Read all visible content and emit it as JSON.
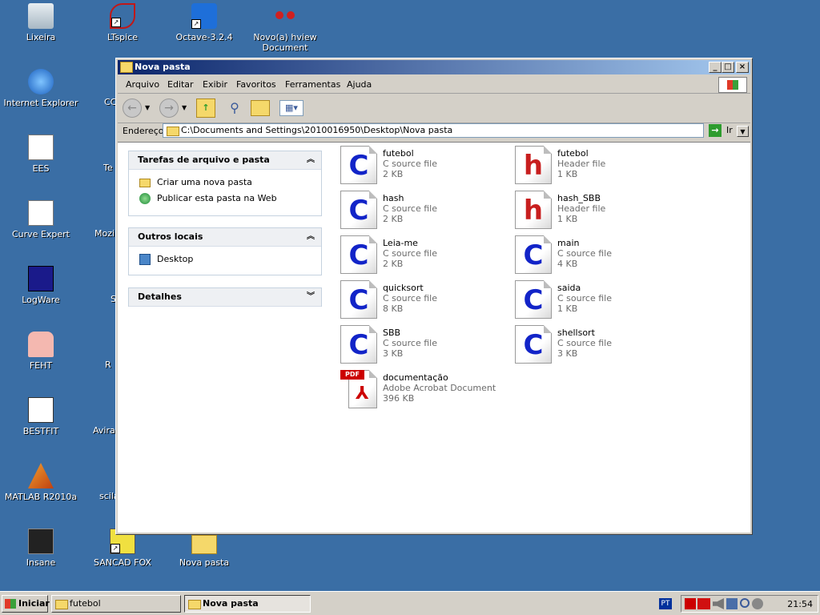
{
  "desktop": {
    "icons": [
      {
        "label": "Lixeira",
        "icon": "recycle-bin-icon"
      },
      {
        "label": "LTspice",
        "icon": "ltspice-icon"
      },
      {
        "label": "Octave-3.2.4",
        "icon": "octave-icon"
      },
      {
        "label": "Novo(a) hview Document",
        "icon": "hview-document-icon"
      },
      {
        "label": "Internet Explorer",
        "icon": "internet-explorer-icon"
      },
      {
        "label": "EES",
        "icon": "ees-icon"
      },
      {
        "label": "Curve Expert",
        "icon": "curve-expert-icon"
      },
      {
        "label": "LogWare",
        "icon": "logware-icon"
      },
      {
        "label": "FEHT",
        "icon": "feht-icon"
      },
      {
        "label": "BESTFIT",
        "icon": "bestfit-icon"
      },
      {
        "label": "MATLAB R2010a",
        "icon": "matlab-icon"
      },
      {
        "label": "Insane",
        "icon": "insane-icon"
      },
      {
        "label": "SANCAD FOX",
        "icon": "sancad-icon"
      },
      {
        "label": "Nova pasta",
        "icon": "folder-icon"
      }
    ],
    "partial_labels": [
      "CC",
      "Te",
      "Mozill",
      "S",
      "R",
      "Avira",
      "scila"
    ]
  },
  "window": {
    "title": "Nova pasta",
    "menu": [
      "Arquivo",
      "Editar",
      "Exibir",
      "Favoritos",
      "Ferramentas",
      "Ajuda"
    ],
    "address_label": "Endereço",
    "address_value": "C:\\Documents and Settings\\2010016950\\Desktop\\Nova pasta",
    "go_label": "Ir"
  },
  "sidebar": {
    "tasks_title": "Tarefas de arquivo e pasta",
    "tasks": [
      {
        "label": "Criar uma nova pasta",
        "icon": "new-folder-icon"
      },
      {
        "label": "Publicar esta pasta na Web",
        "icon": "publish-web-icon"
      }
    ],
    "places_title": "Outros locais",
    "places": [
      {
        "label": "Desktop",
        "icon": "desktop-icon"
      }
    ],
    "details_title": "Detalhes"
  },
  "files": [
    {
      "name": "futebol",
      "type": "C source file",
      "size": "2 KB",
      "kind": "c"
    },
    {
      "name": "futebol",
      "type": "Header file",
      "size": "1 KB",
      "kind": "h"
    },
    {
      "name": "hash",
      "type": "C source file",
      "size": "2 KB",
      "kind": "c"
    },
    {
      "name": "hash_SBB",
      "type": "Header file",
      "size": "1 KB",
      "kind": "h"
    },
    {
      "name": "Leia-me",
      "type": "C source file",
      "size": "2 KB",
      "kind": "c"
    },
    {
      "name": "main",
      "type": "C source file",
      "size": "4 KB",
      "kind": "c"
    },
    {
      "name": "quicksort",
      "type": "C source file",
      "size": "8 KB",
      "kind": "c"
    },
    {
      "name": "saida",
      "type": "C source file",
      "size": "1 KB",
      "kind": "c"
    },
    {
      "name": "SBB",
      "type": "C source file",
      "size": "3 KB",
      "kind": "c"
    },
    {
      "name": "shellsort",
      "type": "C source file",
      "size": "3 KB",
      "kind": "c"
    },
    {
      "name": "documentação",
      "type": "Adobe Acrobat Document",
      "size": "396 KB",
      "kind": "pdf"
    }
  ],
  "icon_letters": {
    "c": "C",
    "h": "h",
    "pdf_badge": "PDF"
  },
  "taskbar": {
    "start_label": "Iniciar",
    "tasks": [
      {
        "label": "futebol"
      },
      {
        "label": "Nova pasta"
      }
    ],
    "lang": "PT",
    "clock": "21:54"
  }
}
